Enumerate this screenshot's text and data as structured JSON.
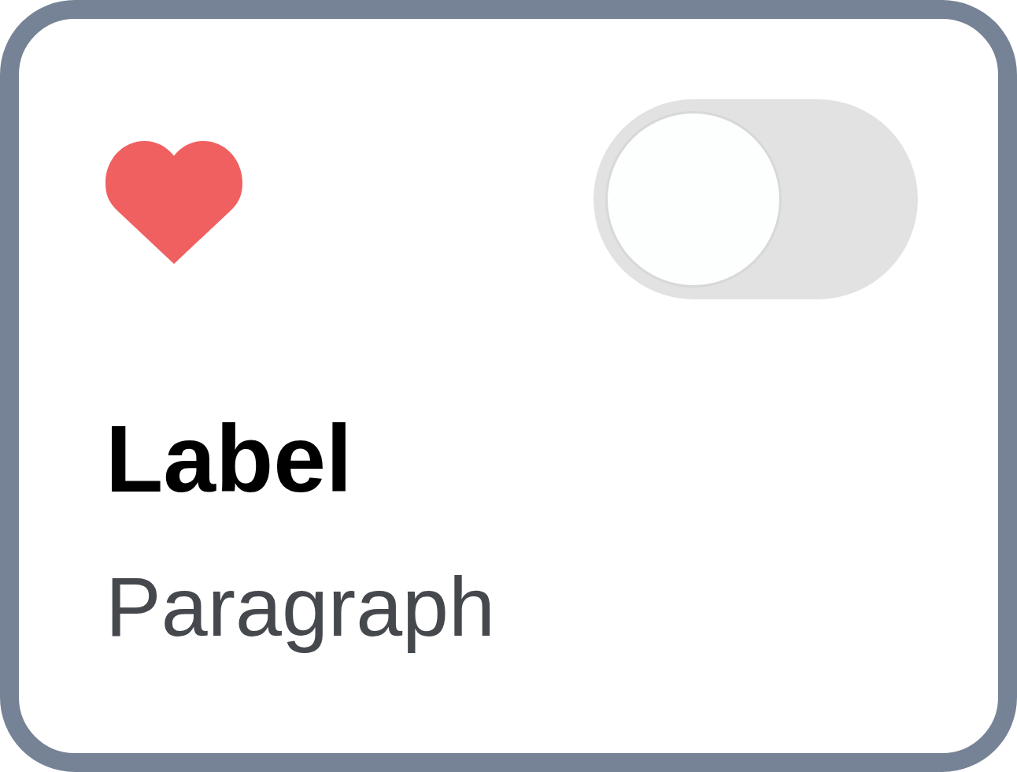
{
  "card": {
    "toggle": {
      "on": false
    },
    "label": "Label",
    "paragraph": "Paragraph"
  }
}
